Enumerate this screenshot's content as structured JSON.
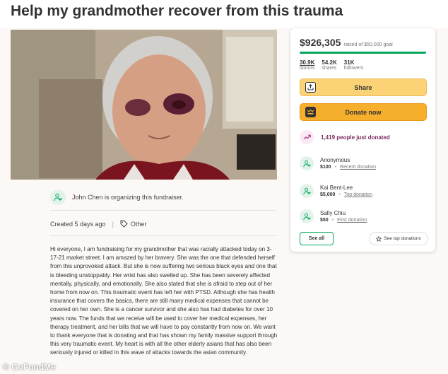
{
  "page": {
    "title": "Help my grandmother recover from this trauma"
  },
  "organizer": {
    "text": "John Chen is organizing this fundraiser."
  },
  "meta": {
    "created": "Created 5 days ago",
    "category": "Other"
  },
  "story": {
    "text": "Hi everyone, I am fundraising for my grandmother that was racially attacked today on 3-17-21 market street. I am amazed by her bravery. She was the one that defended herself from this unprovoked attack. But she is now suffering two serious black eyes and one that is bleeding unstoppably. Her wrist has also swelled up. She has been severely affected mentally, physically, and emotionally. She also stated that she is afraid to step out of her home from now on. This traumatic event has left her with PTSD. Although she has health insurance that covers the basics, there are still many medical expenses that cannot be covered on her own. She is a cancer survivor and she also has had diabetes for over 10 years now. The funds that we receive will be used to cover her medical expenses, her therapy treatment, and her bills that we will have to pay constantly from now on. We want to thank everyone that is donating and that has shown my family massive support through this very traumatic event. My heart is with all the other elderly asians that has also been seriously injured or killed in this wave of attacks towards the asian community."
  },
  "watermark": "GoFundMe",
  "donation_card": {
    "raised_amount": "$926,305",
    "goal_text": "raised of $50,000 goal",
    "progress_fraction": 1.0,
    "stats": [
      {
        "value": "30.9K",
        "label": "donors"
      },
      {
        "value": "54.2K",
        "label": "shares"
      },
      {
        "value": "31K",
        "label": "followers"
      }
    ],
    "share_label": "Share",
    "donate_label": "Donate now",
    "trending_text": "1,419 people just donated",
    "donors": [
      {
        "name": "Anonymous",
        "amount": "$100",
        "tag": "Recent donation"
      },
      {
        "name": "Kai Bent-Lee",
        "amount": "$5,000",
        "tag": "Top donation"
      },
      {
        "name": "Sally Chiu",
        "amount": "$50",
        "tag": "First donation"
      }
    ],
    "see_all_label": "See all",
    "see_top_label": "See top donations"
  },
  "colors": {
    "brand_green": "#02a95c",
    "share_yellow": "#fbd276",
    "donate_orange": "#f6ae2d",
    "trending_text": "#7a2a5e"
  },
  "icons": {
    "organizer": "user-heart-icon",
    "category": "tag-icon",
    "share": "share-icon",
    "donate": "gofundme-logo-icon",
    "trending": "trending-up-icon",
    "donor": "user-heart-icon",
    "see_top": "star-icon"
  }
}
